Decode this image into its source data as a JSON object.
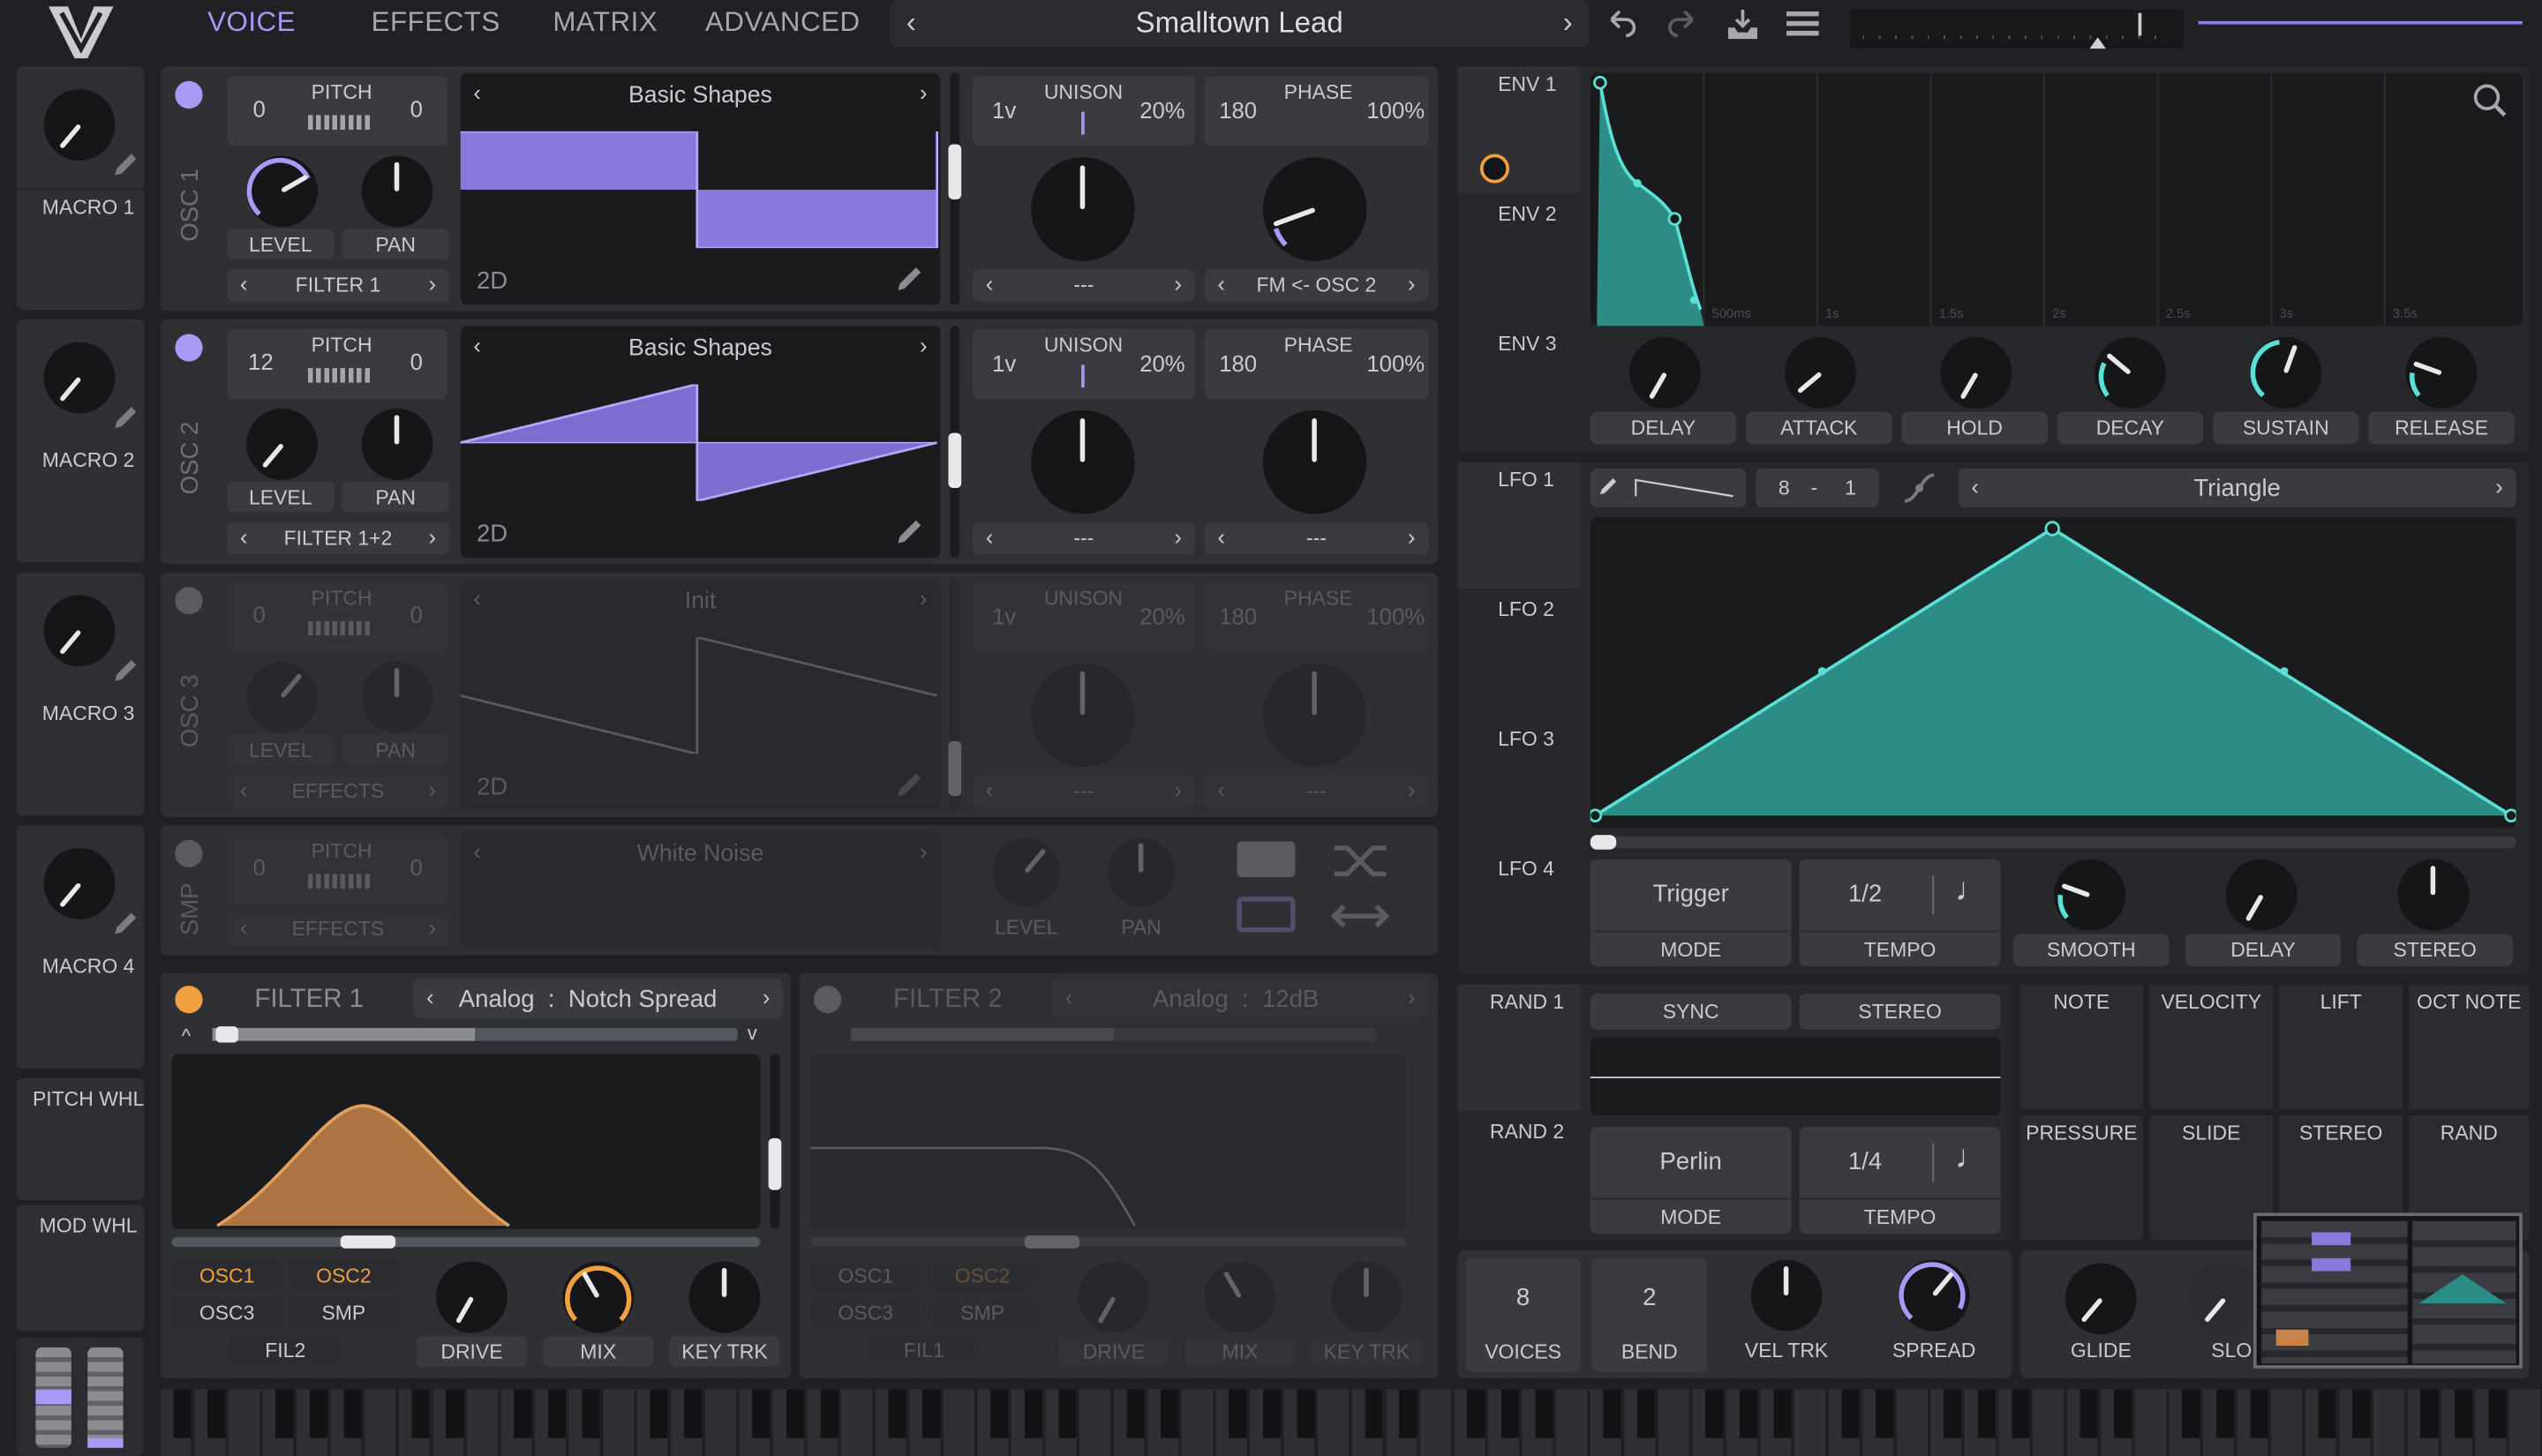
{
  "nav": {
    "tabs": [
      "VOICE",
      "EFFECTS",
      "MATRIX",
      "ADVANCED"
    ],
    "preset_name": "Smalltown Lead"
  },
  "macros": [
    "MACRO 1",
    "MACRO 2",
    "MACRO 3",
    "MACRO 4"
  ],
  "wheels": {
    "pitch": "PITCH WHL",
    "mod": "MOD WHL"
  },
  "osc1": {
    "title": "OSC 1",
    "pitch_coarse": "0",
    "pitch_label": "PITCH",
    "pitch_fine": "0",
    "level": "LEVEL",
    "pan": "PAN",
    "dest": "FILTER 1",
    "wavetable": "Basic Shapes",
    "mode": "2D",
    "unison_voices": "1v",
    "unison_label": "UNISON",
    "unison_detune": "20%",
    "phase_value": "180",
    "phase_label": "PHASE",
    "phase_random": "100%",
    "unison_sub": "---",
    "phase_sub": "FM <- OSC 2"
  },
  "osc2": {
    "title": "OSC 2",
    "pitch_coarse": "12",
    "pitch_label": "PITCH",
    "pitch_fine": "0",
    "level": "LEVEL",
    "pan": "PAN",
    "dest": "FILTER 1+2",
    "wavetable": "Basic Shapes",
    "mode": "2D",
    "unison_voices": "1v",
    "unison_label": "UNISON",
    "unison_detune": "20%",
    "phase_value": "180",
    "phase_label": "PHASE",
    "phase_random": "100%",
    "unison_sub": "---",
    "phase_sub": "---"
  },
  "osc3": {
    "title": "OSC 3",
    "pitch_coarse": "0",
    "pitch_label": "PITCH",
    "pitch_fine": "0",
    "level": "LEVEL",
    "pan": "PAN",
    "dest": "EFFECTS",
    "wavetable": "Init",
    "mode": "2D",
    "unison_voices": "1v",
    "unison_label": "UNISON",
    "unison_detune": "20%",
    "phase_value": "180",
    "phase_label": "PHASE",
    "phase_random": "100%",
    "unison_sub": "---",
    "phase_sub": "---"
  },
  "smp": {
    "title": "SMP",
    "pitch_coarse": "0",
    "pitch_label": "PITCH",
    "pitch_fine": "0",
    "dest": "EFFECTS",
    "sample": "White Noise",
    "level": "LEVEL",
    "pan": "PAN"
  },
  "filter1": {
    "title": "FILTER 1",
    "model": "Analog",
    "type": "Notch Spread",
    "routes": [
      "OSC1",
      "OSC2",
      "OSC3",
      "SMP"
    ],
    "fil": "FIL2",
    "drive": "DRIVE",
    "mix": "MIX",
    "keytrk": "KEY TRK"
  },
  "filter2": {
    "title": "FILTER 2",
    "model": "Analog",
    "type": "12dB",
    "routes": [
      "OSC1",
      "OSC2",
      "OSC3",
      "SMP"
    ],
    "fil": "FIL1",
    "drive": "DRIVE",
    "mix": "MIX",
    "keytrk": "KEY TRK"
  },
  "env": {
    "tabs": [
      "ENV 1",
      "ENV 2",
      "ENV 3"
    ],
    "knobs": [
      "DELAY",
      "ATTACK",
      "HOLD",
      "DECAY",
      "SUSTAIN",
      "RELEASE"
    ],
    "time_marks": [
      "500ms",
      "1s",
      "1.5s",
      "2s",
      "2.5s",
      "3s",
      "3.5s"
    ]
  },
  "lfo": {
    "tabs": [
      "LFO 1",
      "LFO 2",
      "LFO 3",
      "LFO 4"
    ],
    "grid_x": "8",
    "grid_sep": "-",
    "grid_y": "1",
    "shape": "Triangle",
    "mode_value": "Trigger",
    "mode_label": "MODE",
    "tempo_value": "1/2",
    "tempo_label": "TEMPO",
    "knobs": [
      "SMOOTH",
      "DELAY",
      "STEREO"
    ]
  },
  "rand": {
    "tabs": [
      "RAND 1",
      "RAND 2"
    ],
    "sync": "SYNC",
    "stereo": "STEREO",
    "mode_value": "Perlin",
    "mode_label": "MODE",
    "tempo_value": "1/4",
    "tempo_label": "TEMPO"
  },
  "mod_sources": [
    "NOTE",
    "VELOCITY",
    "LIFT",
    "OCT NOTE",
    "PRESSURE",
    "SLIDE",
    "STEREO",
    "RAND"
  ],
  "voice": {
    "voices_value": "8",
    "voices_label": "VOICES",
    "bend_value": "2",
    "bend_label": "BEND",
    "veltrk": "VEL TRK",
    "spread": "SPREAD",
    "glide": "GLIDE",
    "slope": "SLO"
  },
  "colors": {
    "accent": "#a79af4",
    "env": "#2c8d87",
    "filter": "#c9834a",
    "bg": "#1f2124",
    "panel": "#2e3034"
  }
}
